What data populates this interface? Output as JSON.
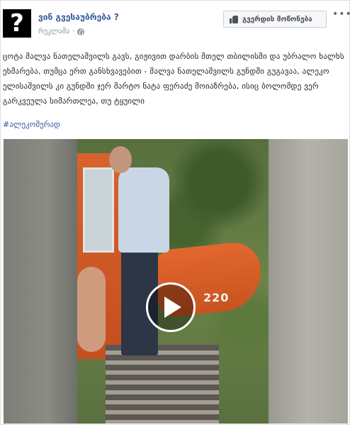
{
  "post": {
    "page_name": "ვინ გვესაუბრება ?",
    "avatar_glyph": "?",
    "sponsored_label": "რეკლამა",
    "separator": "·",
    "like_page_label": "გვერდის მოწონება",
    "more_dots": "•••",
    "text": "ცოტა შალვა ნათელაშვილს გავს, გიჟივით დარბის მთელ თბილისში და უბრალო ხალხს ეხმარება, თუმცა ერთ განსხვავებით - შალვა ნათელაშვილს გუნდში გუგავაა, ალეკო ელისაშვილს კი გუნდში ჯერ მარტო ნატა ფერაძე მოიაზრება, ისიც ბოლომდე ვერ გარკვეულა სიმართლეა, თუ ტყუილი",
    "hashtag": "#ალეკომერად"
  },
  "video": {
    "machine_label": "220",
    "play_icon": "play-icon"
  },
  "colors": {
    "link": "#365899",
    "muted": "#90949c",
    "excavator": "#d9622c"
  }
}
